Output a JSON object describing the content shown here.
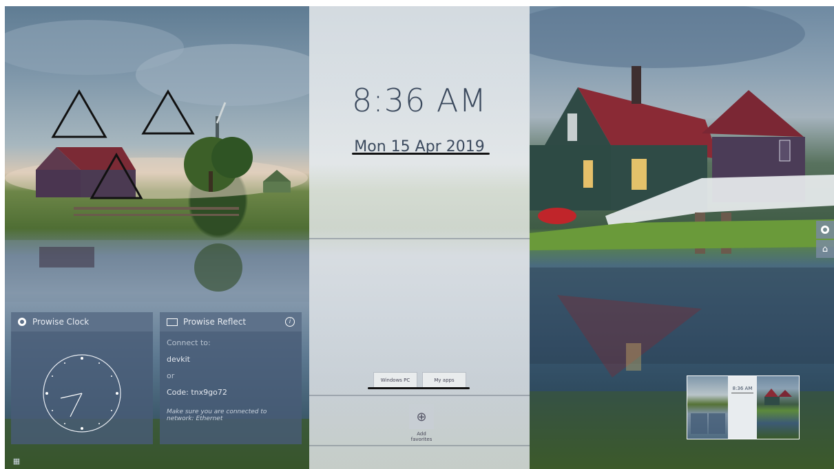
{
  "center": {
    "time": "8:36 AM",
    "date": "Mon 15 Apr 2019",
    "buttons": [
      "Windows PC",
      "My apps"
    ],
    "add_favorites_label": "Add favorites"
  },
  "widgets": {
    "clock": {
      "title": "Prowise Clock"
    },
    "reflect": {
      "title": "Prowise Reflect",
      "connect_label": "Connect to:",
      "device_name": "devkit",
      "or_label": "or",
      "code_label": "Code: tnx9go72",
      "note": "Make sure you are connected to network: Ethernet"
    }
  },
  "thumbnail": {
    "time": "8:36 AM"
  },
  "icons": [
    "prowise-icon",
    "home-icon",
    "apps-grid-icon",
    "info-icon",
    "screen-share-icon",
    "plus-icon"
  ]
}
